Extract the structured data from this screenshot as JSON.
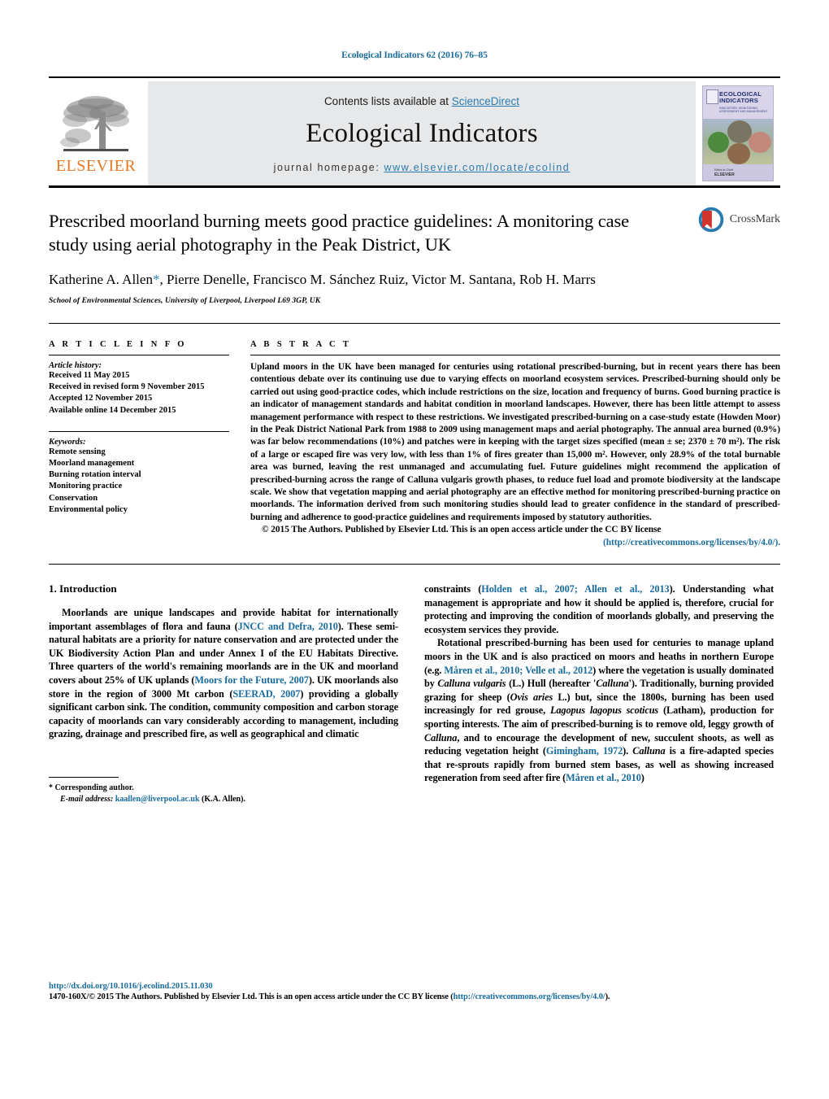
{
  "running_head": "Ecological Indicators 62 (2016) 76–85",
  "masthead": {
    "publisher_name": "ELSEVIER",
    "contents_prefix": "Contents lists available at ",
    "contents_link": "ScienceDirect",
    "journal_title": "Ecological Indicators",
    "homepage_label": "journal homepage: ",
    "homepage_url": "www.elsevier.com/locate/ecolind",
    "cover": {
      "title": "ECOLOGICAL INDICATORS",
      "subtitle": "INDICATORS, MONITORING, ASSESSMENT AND MANAGEMENT",
      "footer_small": "Editor-in-Chief",
      "footer_brand": "ELSEVIER"
    }
  },
  "crossmark": {
    "label": "CrossMark"
  },
  "article": {
    "title": "Prescribed moorland burning meets good practice guidelines: A monitoring case study using aerial photography in the Peak District, UK",
    "authors": "Katherine A. Allen",
    "authors_rest": ", Pierre Denelle, Francisco M. Sánchez Ruiz, Victor M. Santana, Rob H. Marrs",
    "corresponding_marker": "*",
    "affiliation": "School of Environmental Sciences, University of Liverpool, Liverpool L69 3GP, UK"
  },
  "article_info": {
    "heading": "A R T I C L E   I N F O",
    "history_label": "Article history:",
    "history": [
      "Received 11 May 2015",
      "Received in revised form 9 November 2015",
      "Accepted 12 November 2015",
      "Available online 14 December 2015"
    ],
    "keywords_label": "Keywords:",
    "keywords": [
      "Remote sensing",
      "Moorland management",
      "Burning rotation interval",
      "Monitoring practice",
      "Conservation",
      "Environmental policy"
    ]
  },
  "abstract": {
    "heading": "A B S T R A C T",
    "text": "Upland moors in the UK have been managed for centuries using rotational prescribed-burning, but in recent years there has been contentious debate over its continuing use due to varying effects on moorland ecosystem services. Prescribed-burning should only be carried out using good-practice codes, which include restrictions on the size, location and frequency of burns. Good burning practice is an indicator of management standards and habitat condition in moorland landscapes. However, there has been little attempt to assess management performance with respect to these restrictions. We investigated prescribed-burning on a case-study estate (Howden Moor) in the Peak District National Park from 1988 to 2009 using management maps and aerial photography. The annual area burned (0.9%) was far below recommendations (10%) and patches were in keeping with the target sizes specified (mean ± se; 2370 ± 70 m²). The risk of a large or escaped fire was very low, with less than 1% of fires greater than 15,000 m². However, only 28.9% of the total burnable area was burned, leaving the rest unmanaged and accumulating fuel. Future guidelines might recommend the application of prescribed-burning across the range of Calluna vulgaris growth phases, to reduce fuel load and promote biodiversity at the landscape scale. We show that vegetation mapping and aerial photography are an effective method for monitoring prescribed-burning practice on moorlands. The information derived from such monitoring studies should lead to greater confidence in the standard of prescribed-burning and adherence to good-practice guidelines and requirements imposed by statutory authorities.",
    "copyright": "© 2015 The Authors. Published by Elsevier Ltd. This is an open access article under the CC BY license",
    "license_url": "(http://creativecommons.org/licenses/by/4.0/)."
  },
  "introduction": {
    "heading": "1.  Introduction",
    "left_p1": "Moorlands are unique landscapes and provide habitat for internationally important assemblages of flora and fauna (",
    "left_p1_cite1": "JNCC and Defra, 2010",
    "left_p1_b": "). These semi-natural habitats are a priority for nature conservation and are protected under the UK Biodiversity Action Plan and under Annex I of the EU Habitats Directive. Three quarters of the world's remaining moorlands are in the UK and moorland covers about 25% of UK uplands (",
    "left_p1_cite2": "Moors for the Future, 2007",
    "left_p1_c": "). UK moorlands also store in the region of 3000 Mt carbon (",
    "left_p1_cite3": "SEERAD, 2007",
    "left_p1_d": ") providing a globally significant carbon sink. The condition, community composition and carbon storage capacity of moorlands can vary considerably according to management, including grazing, drainage and prescribed fire, as well as geographical and climatic",
    "right_p1_a": "constraints (",
    "right_p1_cite1": "Holden et al., 2007; Allen et al., 2013",
    "right_p1_b": "). Understanding what management is appropriate and how it should be applied is, therefore, crucial for protecting and improving the condition of moorlands globally, and preserving the ecosystem services they provide.",
    "right_p2_a": "Rotational prescribed-burning has been used for centuries to manage upland moors in the UK and is also practiced on moors and heaths in northern Europe (e.g. ",
    "right_p2_cite1": "Måren et al., 2010; Velle et al., 2012",
    "right_p2_b": ") where the vegetation is usually dominated by ",
    "right_p2_i1": "Calluna vulgaris",
    "right_p2_c": " (L.) Hull (hereafter '",
    "right_p2_i2": "Calluna",
    "right_p2_d": "'). Traditionally, burning provided grazing for sheep (",
    "right_p2_i3": "Ovis aries",
    "right_p2_e": " L.) but, since the 1800s, burning has been used increasingly for red grouse, ",
    "right_p2_i4": "Lagopus lagopus scoticus",
    "right_p2_f": " (Latham), production for sporting interests. The aim of prescribed-burning is to remove old, leggy growth of ",
    "right_p2_i5": "Calluna",
    "right_p2_g": ", and to encourage the development of new, succulent shoots, as well as reducing vegetation height (",
    "right_p2_cite2": "Gimingham, 1972",
    "right_p2_h": "). ",
    "right_p2_i6": "Calluna",
    "right_p2_i": " is a fire-adapted species that re-sprouts rapidly from burned stem bases, as well as showing increased regeneration from seed after fire (",
    "right_p2_cite3": "Måren et al., 2010",
    "right_p2_j": ")"
  },
  "footnote": {
    "corresponding": "*  Corresponding author.",
    "email_label": "E-mail address:",
    "email": "kaallen@liverpool.ac.uk",
    "email_suffix": " (K.A. Allen)."
  },
  "page_footer": {
    "doi": "http://dx.doi.org/10.1016/j.ecolind.2015.11.030",
    "issn_line": "1470-160X/© 2015 The Authors. Published by Elsevier Ltd. This is an open access article under the CC BY license (",
    "issn_link": "http://creativecommons.org/licenses/by/4.0/",
    "issn_tail": ")."
  },
  "colors": {
    "link": "#1a6c9c",
    "elsevier_orange": "#E87722",
    "band_gray": "#e7e8ea"
  }
}
